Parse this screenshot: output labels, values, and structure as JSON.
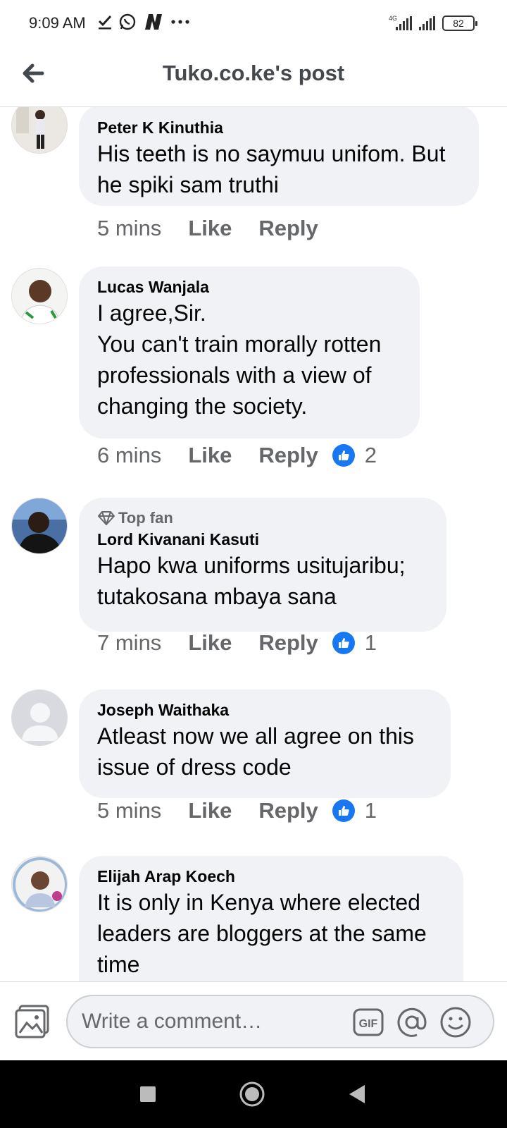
{
  "status_bar": {
    "time": "9:09 AM",
    "network": "4G",
    "battery": "82",
    "icons": [
      "check-icon",
      "whatsapp-icon",
      "n-app-icon",
      "more-dots-icon",
      "signal-icon",
      "battery-icon"
    ]
  },
  "header": {
    "title": "Tuko.co.ke's post",
    "back_icon": "arrow-left-icon"
  },
  "comments": [
    {
      "author": "Peter K Kinuthia",
      "lines": [
        "His teeth is no saymuu unifom. But",
        "he spiki sam truthi"
      ],
      "time": "5 mins",
      "like_label": "Like",
      "reply_label": "Reply",
      "reactions": ""
    },
    {
      "author": "Lucas Wanjala",
      "lines": [
        "I agree,Sir.",
        "You can't train morally rotten",
        "professionals with a view of",
        "changing the society."
      ],
      "time": "6 mins",
      "like_label": "Like",
      "reply_label": "Reply",
      "reactions": "2"
    },
    {
      "badge": "Top fan",
      "author": "Lord Kivanani Kasuti",
      "lines": [
        "Hapo kwa uniforms usitujaribu;",
        "tutakosana mbaya sana"
      ],
      "time": "7 mins",
      "like_label": "Like",
      "reply_label": "Reply",
      "reactions": "1"
    },
    {
      "author": "Joseph Waithaka",
      "lines": [
        "Atleast now we all agree on this",
        "issue of dress code"
      ],
      "time": "5 mins",
      "like_label": "Like",
      "reply_label": "Reply",
      "reactions": "1"
    },
    {
      "author": "Elijah Arap Koech",
      "lines": [
        "It is only in Kenya where elected",
        "leaders are bloggers at the same",
        "time"
      ]
    }
  ],
  "composer": {
    "placeholder": "Write a comment…",
    "icons": [
      "photo-icon",
      "gif-icon",
      "mention-icon",
      "emoji-icon"
    ]
  },
  "colors": {
    "bubble": "#f0f2f5",
    "secondary_text": "#65676b",
    "like_blue": "#1877f2",
    "nav_bar": "#000000"
  }
}
